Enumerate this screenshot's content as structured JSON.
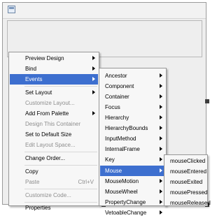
{
  "context_menu": {
    "items": [
      {
        "label": "Preview Design",
        "submenu": true
      },
      {
        "label": "Bind",
        "submenu": true
      },
      {
        "label": "Events",
        "submenu": true,
        "selected": true
      },
      {
        "label": "Set Layout",
        "submenu": true
      },
      {
        "label": "Customize Layout...",
        "disabled": true
      },
      {
        "label": "Add From Palette",
        "submenu": true
      },
      {
        "label": "Design This Container",
        "disabled": true
      },
      {
        "label": "Set to Default Size"
      },
      {
        "label": "Edit Layout Space...",
        "disabled": true
      },
      {
        "label": "Change Order..."
      },
      {
        "label": "Copy"
      },
      {
        "label": "Paste",
        "disabled": true,
        "shortcut": "Ctrl+V"
      },
      {
        "label": "Customize Code...",
        "disabled": true
      },
      {
        "label": "Properties"
      }
    ]
  },
  "events_menu": {
    "items": [
      {
        "label": "Ancestor"
      },
      {
        "label": "Component"
      },
      {
        "label": "Container"
      },
      {
        "label": "Focus"
      },
      {
        "label": "Hierarchy"
      },
      {
        "label": "HierarchyBounds"
      },
      {
        "label": "InputMethod"
      },
      {
        "label": "InternalFrame"
      },
      {
        "label": "Key"
      },
      {
        "label": "Mouse",
        "selected": true
      },
      {
        "label": "MouseMotion"
      },
      {
        "label": "MouseWheel"
      },
      {
        "label": "PropertyChange"
      },
      {
        "label": "VetoableChange"
      }
    ]
  },
  "mouse_menu": {
    "items": [
      {
        "label": "mouseClicked"
      },
      {
        "label": "mouseEntered"
      },
      {
        "label": "mouseExited"
      },
      {
        "label": "mousePressed"
      },
      {
        "label": "mouseReleased"
      }
    ]
  }
}
